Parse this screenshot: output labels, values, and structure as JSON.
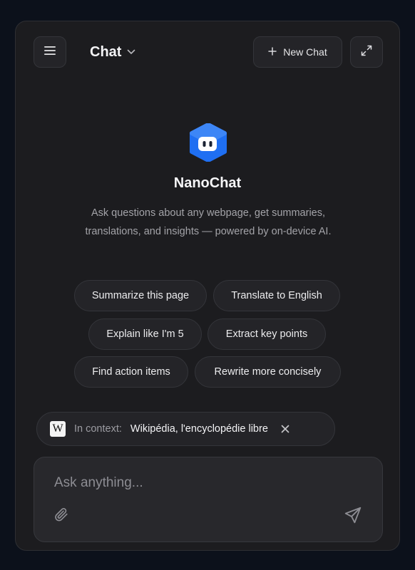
{
  "header": {
    "title": "Chat",
    "new_chat_label": "New Chat",
    "icons": {
      "menu": "hamburger-menu-icon",
      "title_dropdown": "chevron-down-icon",
      "new_chat": "plus-icon",
      "expand": "expand-icon"
    }
  },
  "hero": {
    "app_name": "NanoChat",
    "tagline": "Ask questions about any webpage, get summaries, translations, and insights — powered by on-device AI.",
    "logo_icon": "robot-face-icon",
    "logo_color": "#1f6ff2"
  },
  "suggestions": [
    {
      "label": "Summarize this page"
    },
    {
      "label": "Translate to English"
    },
    {
      "label": "Explain like I'm 5"
    },
    {
      "label": "Extract key points"
    },
    {
      "label": "Find action items"
    },
    {
      "label": "Rewrite more concisely"
    }
  ],
  "context": {
    "badge": "W",
    "label": "In context:",
    "value": "Wikipédia, l'encyclopédie libre",
    "close_icon": "close-icon"
  },
  "composer": {
    "placeholder": "Ask anything...",
    "value": "",
    "attach_icon": "paperclip-icon",
    "send_icon": "send-icon"
  },
  "colors": {
    "page_background": "#0c111b",
    "panel_background": "#1c1c1f",
    "accent": "#1f6ff2"
  }
}
